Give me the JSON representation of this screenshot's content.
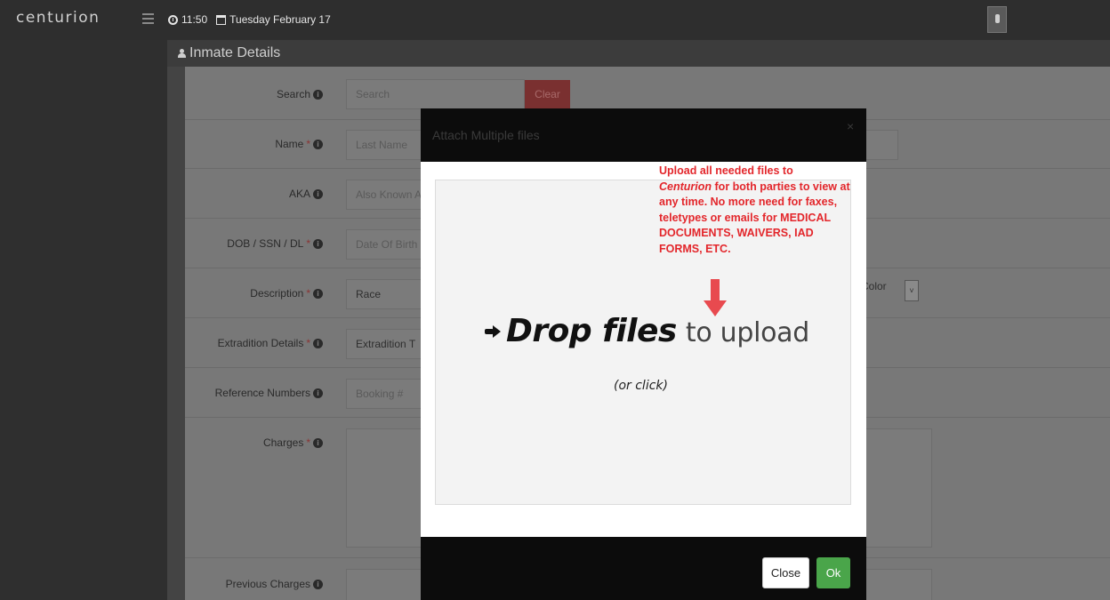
{
  "topbar": {
    "brand": "centurion",
    "time": "11:50",
    "date": "Tuesday February 17"
  },
  "panel": {
    "title": "Inmate Details"
  },
  "form": {
    "search": {
      "label": "Search",
      "placeholder": "Search",
      "clear_label": "Clear"
    },
    "name": {
      "label": "Name",
      "placeholder": "Last Name"
    },
    "aka": {
      "label": "AKA",
      "placeholder": "Also Known A"
    },
    "dob": {
      "label": "DOB / SSN / DL",
      "placeholder": "Date Of Birth"
    },
    "description": {
      "label": "Description",
      "race_value": "Race",
      "hair_color_label": "Color"
    },
    "extradition": {
      "label": "Extradition Details",
      "value": "Extradition T"
    },
    "reference": {
      "label": "Reference Numbers",
      "placeholder": "Booking #"
    },
    "charges": {
      "label": "Charges"
    },
    "previous_charges": {
      "label": "Previous Charges"
    },
    "required_mark": "*"
  },
  "modal": {
    "title": "Attach Multiple files",
    "close_x": "×",
    "annotation_line1_pre": "Upload all needed files to",
    "annotation_brand": "Centurion",
    "annotation_rest": "for both parties to view at any time. No more need for faxes, teletypes or emails for MEDICAL DOCUMENTS, WAIVERS, IAD FORMS, ETC.",
    "drop_bold": "Drop files",
    "drop_light": "to upload",
    "drop_sub": "(or click)",
    "close_label": "Close",
    "ok_label": "Ok"
  },
  "colors": {
    "accent_red": "#e3262b",
    "ok_green": "#4aa54a"
  }
}
